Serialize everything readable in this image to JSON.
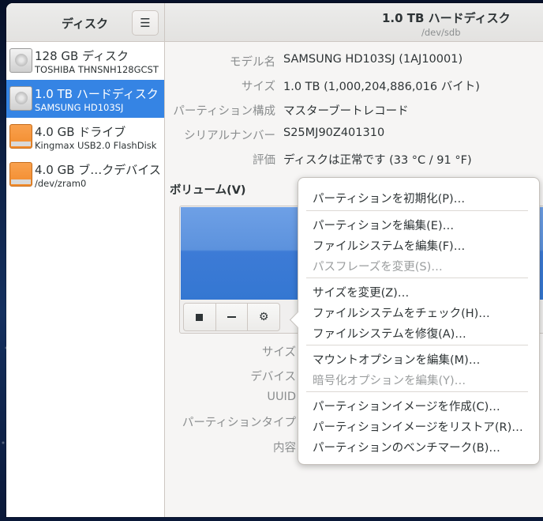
{
  "sidebar": {
    "title": "ディスク",
    "menu_icon": "hamburger-menu-icon",
    "drives": [
      {
        "name": "128 GB ディスク",
        "detail": "TOSHIBA THNSNH128GCST",
        "icon": "hard-disk-icon"
      },
      {
        "name": "1.0 TB ハードディスク",
        "detail": "SAMSUNG HD103SJ",
        "icon": "hard-disk-icon",
        "selected": true
      },
      {
        "name": "4.0 GB ドライブ",
        "detail": "Kingmax USB2.0 FlashDisk",
        "icon": "usb-drive-icon"
      },
      {
        "name": "4.0 GB ブ…クデバイス",
        "detail": "/dev/zram0",
        "icon": "block-device-icon"
      }
    ]
  },
  "header": {
    "title": "1.0 TB ハードディスク",
    "subtitle": "/dev/sdb"
  },
  "properties": [
    {
      "key": "モデル名",
      "value": "SAMSUNG HD103SJ (1AJ10001)"
    },
    {
      "key": "サイズ",
      "value": "1.0 TB (1,000,204,886,016 バイト)"
    },
    {
      "key": "パーティション構成",
      "value": "マスターブートレコード"
    },
    {
      "key": "シリアルナンバー",
      "value": "S25MJ90Z401310"
    },
    {
      "key": "評価",
      "value": "ディスクは正常です (33 °C / 91 °F)"
    }
  ],
  "volumes": {
    "title": "ボリューム(V)",
    "toolbar": {
      "stop": "stop-icon",
      "remove": "minus-icon",
      "settings": "gears-icon"
    }
  },
  "volume_details": [
    {
      "key": "サイズ"
    },
    {
      "key": "デバイス"
    },
    {
      "key": "UUID"
    },
    {
      "key": "パーティションタイプ"
    },
    {
      "key": "内容"
    }
  ],
  "menu": {
    "items": [
      {
        "label": "パーティションを初期化(P)…",
        "enabled": true
      },
      {
        "label": "パーティションを編集(E)…",
        "enabled": true
      },
      {
        "label": "ファイルシステムを編集(F)…",
        "enabled": true
      },
      {
        "label": "パスフレーズを変更(S)…",
        "enabled": false
      },
      {
        "label": "サイズを変更(Z)…",
        "enabled": true
      },
      {
        "label": "ファイルシステムをチェック(H)…",
        "enabled": true
      },
      {
        "label": "ファイルシステムを修復(A)…",
        "enabled": true
      },
      {
        "label": "マウントオプションを編集(M)…",
        "enabled": true
      },
      {
        "label": "暗号化オプションを編集(Y)…",
        "enabled": false
      },
      {
        "label": "パーティションイメージを作成(C)…",
        "enabled": true
      },
      {
        "label": "パーティションイメージをリストア(R)…",
        "enabled": true
      },
      {
        "label": "パーティションのベンチマーク(B)…",
        "enabled": true
      }
    ]
  },
  "truncated_text": "ト",
  "colors": {
    "selection": "#3584e4",
    "volume_bar": "#3477d2"
  }
}
